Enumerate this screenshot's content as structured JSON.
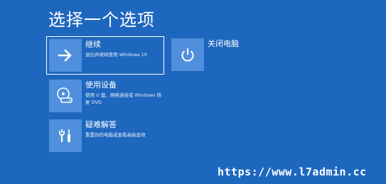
{
  "page": {
    "title": "选择一个选项"
  },
  "options": [
    {
      "label": "继续",
      "description": "退出并继续使用 Windows 10",
      "icon": "arrow-right-icon"
    },
    {
      "label": "关闭电脑",
      "description": "",
      "icon": "power-icon"
    },
    {
      "label": "使用设备",
      "description": "使用 U 盘、网络连接或 Windows 恢复 DVD",
      "icon": "disc-drive-icon"
    },
    {
      "label": "疑难解答",
      "description": "重置你的电脑或查看高级选项",
      "icon": "tools-icon"
    }
  ],
  "watermark": "https://www.l7admin.cc",
  "colors": {
    "background": "#1e67bf",
    "tile": "#4f8fdb",
    "text": "#ffffff"
  }
}
